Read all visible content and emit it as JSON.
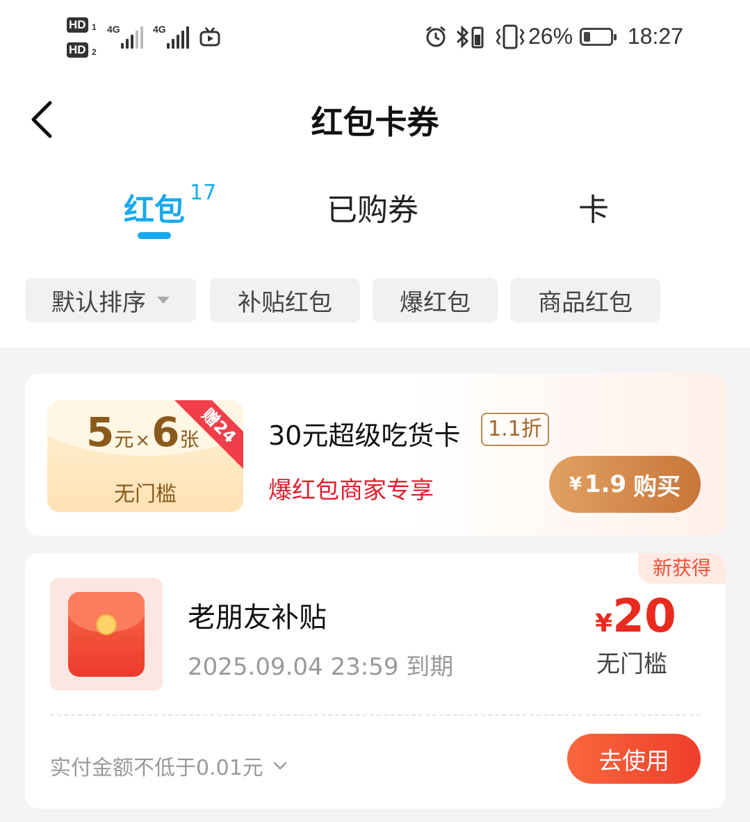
{
  "status_bar": {
    "sim1": "HD",
    "sim1_num": "1",
    "sim2": "HD",
    "sim2_num": "2",
    "net1": "4G",
    "net2": "4G",
    "battery_pct": "26%",
    "battery_level": 0.26,
    "time": "18:27"
  },
  "header": {
    "title": "红包卡券",
    "back_icon": "chevron-left-icon"
  },
  "tabs": [
    {
      "label": "红包",
      "badge": "17",
      "active": true
    },
    {
      "label": "已购券"
    },
    {
      "label": "卡"
    }
  ],
  "filters": [
    "默认排序",
    "补贴红包",
    "爆红包",
    "商品红包"
  ],
  "promo_card": {
    "coupon_amount": "5",
    "coupon_unit": "元",
    "times": "×",
    "coupon_count": "6",
    "coupon_count_unit": "张",
    "ribbon": "赠24",
    "coupon_note": "无门槛",
    "title": "30元超级吃货卡",
    "discount": "1.1折",
    "subtitle": "爆红包商家专享",
    "buy_currency": "¥",
    "buy_price": "1.9",
    "buy_label": "购买"
  },
  "redpacket_card": {
    "new_tag": "新获得",
    "name": "老朋友补贴",
    "expiry": "2025.09.04 23:59 到期",
    "currency": "¥",
    "amount": "20",
    "threshold": "无门槛",
    "condition": "实付金额不低于0.01元",
    "use_label": "去使用"
  },
  "colors": {
    "accent": "#18a9ef",
    "red": "#e92a1e",
    "gold": "#8a5a1c"
  }
}
